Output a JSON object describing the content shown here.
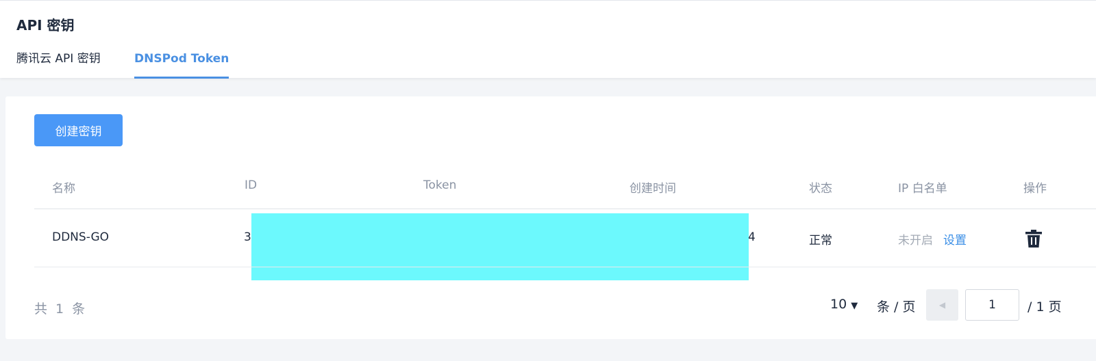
{
  "header": {
    "title": "API 密钥",
    "tabs": [
      {
        "label": "腾讯云 API 密钥"
      },
      {
        "label": "DNSPod Token"
      }
    ]
  },
  "toolbar": {
    "create_label": "创建密钥"
  },
  "table": {
    "columns": [
      "名称",
      "ID",
      "Token",
      "创建时间",
      "状态",
      "IP 白名单",
      "操作"
    ],
    "rows": [
      {
        "name": "DDNS-GO",
        "id_visible_prefix": "3",
        "visible_suffix": "4",
        "status": "正常",
        "ip_whitelist_state": "未开启",
        "ip_whitelist_action": "设置",
        "action_icon": "trash-icon"
      }
    ]
  },
  "pagination": {
    "total_label": "共 1 条",
    "page_size": "10",
    "per_page_label": "条 / 页",
    "current_page": "1",
    "total_pages_label": "/ 1 页"
  },
  "colors": {
    "accent": "#4a90e2",
    "button": "#4a98f7",
    "redaction": "#6cf9fd"
  }
}
